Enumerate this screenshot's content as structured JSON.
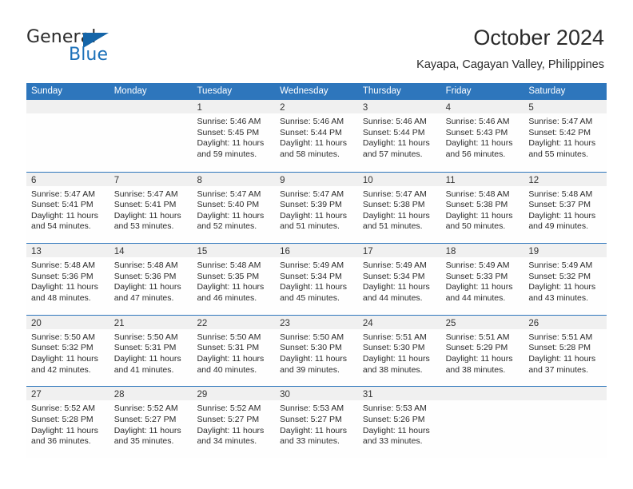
{
  "brand": {
    "name_part1": "General",
    "name_part2": "Blue",
    "logo_icon": "triangle-flag-icon",
    "accent_color": "#1565a8"
  },
  "header": {
    "title": "October 2024",
    "subtitle": "Kayapa, Cagayan Valley, Philippines"
  },
  "theme": {
    "header_row_color": "#2e76bc",
    "day_band_color": "#f0f0f0",
    "grid_line_color": "#2e76bc"
  },
  "calendar": {
    "weekday_headers": [
      "Sunday",
      "Monday",
      "Tuesday",
      "Wednesday",
      "Thursday",
      "Friday",
      "Saturday"
    ],
    "weeks": [
      [
        {
          "day": "",
          "sunrise": "",
          "sunset": "",
          "daylight_line1": "",
          "daylight_line2": ""
        },
        {
          "day": "",
          "sunrise": "",
          "sunset": "",
          "daylight_line1": "",
          "daylight_line2": ""
        },
        {
          "day": "1",
          "sunrise": "Sunrise: 5:46 AM",
          "sunset": "Sunset: 5:45 PM",
          "daylight_line1": "Daylight: 11 hours",
          "daylight_line2": "and 59 minutes."
        },
        {
          "day": "2",
          "sunrise": "Sunrise: 5:46 AM",
          "sunset": "Sunset: 5:44 PM",
          "daylight_line1": "Daylight: 11 hours",
          "daylight_line2": "and 58 minutes."
        },
        {
          "day": "3",
          "sunrise": "Sunrise: 5:46 AM",
          "sunset": "Sunset: 5:44 PM",
          "daylight_line1": "Daylight: 11 hours",
          "daylight_line2": "and 57 minutes."
        },
        {
          "day": "4",
          "sunrise": "Sunrise: 5:46 AM",
          "sunset": "Sunset: 5:43 PM",
          "daylight_line1": "Daylight: 11 hours",
          "daylight_line2": "and 56 minutes."
        },
        {
          "day": "5",
          "sunrise": "Sunrise: 5:47 AM",
          "sunset": "Sunset: 5:42 PM",
          "daylight_line1": "Daylight: 11 hours",
          "daylight_line2": "and 55 minutes."
        }
      ],
      [
        {
          "day": "6",
          "sunrise": "Sunrise: 5:47 AM",
          "sunset": "Sunset: 5:41 PM",
          "daylight_line1": "Daylight: 11 hours",
          "daylight_line2": "and 54 minutes."
        },
        {
          "day": "7",
          "sunrise": "Sunrise: 5:47 AM",
          "sunset": "Sunset: 5:41 PM",
          "daylight_line1": "Daylight: 11 hours",
          "daylight_line2": "and 53 minutes."
        },
        {
          "day": "8",
          "sunrise": "Sunrise: 5:47 AM",
          "sunset": "Sunset: 5:40 PM",
          "daylight_line1": "Daylight: 11 hours",
          "daylight_line2": "and 52 minutes."
        },
        {
          "day": "9",
          "sunrise": "Sunrise: 5:47 AM",
          "sunset": "Sunset: 5:39 PM",
          "daylight_line1": "Daylight: 11 hours",
          "daylight_line2": "and 51 minutes."
        },
        {
          "day": "10",
          "sunrise": "Sunrise: 5:47 AM",
          "sunset": "Sunset: 5:38 PM",
          "daylight_line1": "Daylight: 11 hours",
          "daylight_line2": "and 51 minutes."
        },
        {
          "day": "11",
          "sunrise": "Sunrise: 5:48 AM",
          "sunset": "Sunset: 5:38 PM",
          "daylight_line1": "Daylight: 11 hours",
          "daylight_line2": "and 50 minutes."
        },
        {
          "day": "12",
          "sunrise": "Sunrise: 5:48 AM",
          "sunset": "Sunset: 5:37 PM",
          "daylight_line1": "Daylight: 11 hours",
          "daylight_line2": "and 49 minutes."
        }
      ],
      [
        {
          "day": "13",
          "sunrise": "Sunrise: 5:48 AM",
          "sunset": "Sunset: 5:36 PM",
          "daylight_line1": "Daylight: 11 hours",
          "daylight_line2": "and 48 minutes."
        },
        {
          "day": "14",
          "sunrise": "Sunrise: 5:48 AM",
          "sunset": "Sunset: 5:36 PM",
          "daylight_line1": "Daylight: 11 hours",
          "daylight_line2": "and 47 minutes."
        },
        {
          "day": "15",
          "sunrise": "Sunrise: 5:48 AM",
          "sunset": "Sunset: 5:35 PM",
          "daylight_line1": "Daylight: 11 hours",
          "daylight_line2": "and 46 minutes."
        },
        {
          "day": "16",
          "sunrise": "Sunrise: 5:49 AM",
          "sunset": "Sunset: 5:34 PM",
          "daylight_line1": "Daylight: 11 hours",
          "daylight_line2": "and 45 minutes."
        },
        {
          "day": "17",
          "sunrise": "Sunrise: 5:49 AM",
          "sunset": "Sunset: 5:34 PM",
          "daylight_line1": "Daylight: 11 hours",
          "daylight_line2": "and 44 minutes."
        },
        {
          "day": "18",
          "sunrise": "Sunrise: 5:49 AM",
          "sunset": "Sunset: 5:33 PM",
          "daylight_line1": "Daylight: 11 hours",
          "daylight_line2": "and 44 minutes."
        },
        {
          "day": "19",
          "sunrise": "Sunrise: 5:49 AM",
          "sunset": "Sunset: 5:32 PM",
          "daylight_line1": "Daylight: 11 hours",
          "daylight_line2": "and 43 minutes."
        }
      ],
      [
        {
          "day": "20",
          "sunrise": "Sunrise: 5:50 AM",
          "sunset": "Sunset: 5:32 PM",
          "daylight_line1": "Daylight: 11 hours",
          "daylight_line2": "and 42 minutes."
        },
        {
          "day": "21",
          "sunrise": "Sunrise: 5:50 AM",
          "sunset": "Sunset: 5:31 PM",
          "daylight_line1": "Daylight: 11 hours",
          "daylight_line2": "and 41 minutes."
        },
        {
          "day": "22",
          "sunrise": "Sunrise: 5:50 AM",
          "sunset": "Sunset: 5:31 PM",
          "daylight_line1": "Daylight: 11 hours",
          "daylight_line2": "and 40 minutes."
        },
        {
          "day": "23",
          "sunrise": "Sunrise: 5:50 AM",
          "sunset": "Sunset: 5:30 PM",
          "daylight_line1": "Daylight: 11 hours",
          "daylight_line2": "and 39 minutes."
        },
        {
          "day": "24",
          "sunrise": "Sunrise: 5:51 AM",
          "sunset": "Sunset: 5:30 PM",
          "daylight_line1": "Daylight: 11 hours",
          "daylight_line2": "and 38 minutes."
        },
        {
          "day": "25",
          "sunrise": "Sunrise: 5:51 AM",
          "sunset": "Sunset: 5:29 PM",
          "daylight_line1": "Daylight: 11 hours",
          "daylight_line2": "and 38 minutes."
        },
        {
          "day": "26",
          "sunrise": "Sunrise: 5:51 AM",
          "sunset": "Sunset: 5:28 PM",
          "daylight_line1": "Daylight: 11 hours",
          "daylight_line2": "and 37 minutes."
        }
      ],
      [
        {
          "day": "27",
          "sunrise": "Sunrise: 5:52 AM",
          "sunset": "Sunset: 5:28 PM",
          "daylight_line1": "Daylight: 11 hours",
          "daylight_line2": "and 36 minutes."
        },
        {
          "day": "28",
          "sunrise": "Sunrise: 5:52 AM",
          "sunset": "Sunset: 5:27 PM",
          "daylight_line1": "Daylight: 11 hours",
          "daylight_line2": "and 35 minutes."
        },
        {
          "day": "29",
          "sunrise": "Sunrise: 5:52 AM",
          "sunset": "Sunset: 5:27 PM",
          "daylight_line1": "Daylight: 11 hours",
          "daylight_line2": "and 34 minutes."
        },
        {
          "day": "30",
          "sunrise": "Sunrise: 5:53 AM",
          "sunset": "Sunset: 5:27 PM",
          "daylight_line1": "Daylight: 11 hours",
          "daylight_line2": "and 33 minutes."
        },
        {
          "day": "31",
          "sunrise": "Sunrise: 5:53 AM",
          "sunset": "Sunset: 5:26 PM",
          "daylight_line1": "Daylight: 11 hours",
          "daylight_line2": "and 33 minutes."
        },
        {
          "day": "",
          "sunrise": "",
          "sunset": "",
          "daylight_line1": "",
          "daylight_line2": ""
        },
        {
          "day": "",
          "sunrise": "",
          "sunset": "",
          "daylight_line1": "",
          "daylight_line2": ""
        }
      ]
    ]
  }
}
